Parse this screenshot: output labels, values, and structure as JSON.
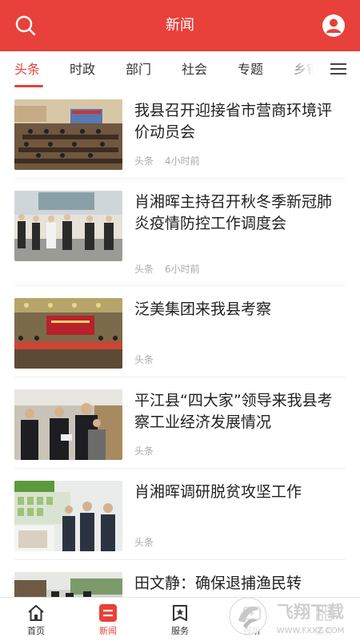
{
  "header": {
    "title": "新闻",
    "search_icon": "search-icon",
    "user_icon": "user-icon",
    "accent": "#e8403a"
  },
  "tabs": [
    {
      "label": "头条",
      "active": true
    },
    {
      "label": "时政",
      "active": false
    },
    {
      "label": "部门",
      "active": false
    },
    {
      "label": "社会",
      "active": false
    },
    {
      "label": "专题",
      "active": false
    },
    {
      "label": "乡镇",
      "active": false
    }
  ],
  "menu_icon": "menu-icon",
  "news": [
    {
      "title": "我县召开迎接省市营商环境评价动员会",
      "source": "头条",
      "time": "4小时前"
    },
    {
      "title": "肖湘晖主持召开秋冬季新冠肺炎疫情防控工作调度会",
      "source": "头条",
      "time": "6小时前"
    },
    {
      "title": "泛美集团来我县考察",
      "source": "头条",
      "time": ""
    },
    {
      "title": "平江县“四大家”领导来我县考察工业经济发展情况",
      "source": "头条",
      "time": ""
    },
    {
      "title": "肖湘晖调研脱贫攻坚工作",
      "source": "头条",
      "time": ""
    },
    {
      "title": "田文静：确保退捕渔民转",
      "source": "",
      "time": ""
    }
  ],
  "tabbar": [
    {
      "label": "首页",
      "icon": "home-icon",
      "active": false
    },
    {
      "label": "新闻",
      "icon": "news-icon",
      "active": true
    },
    {
      "label": "服务",
      "icon": "service-icon",
      "active": false
    },
    {
      "label": "视听",
      "icon": "video-icon",
      "active": false
    },
    {
      "label": "服务",
      "icon": "grid-icon",
      "active": false
    }
  ],
  "watermark": {
    "brand": "飞翔下载",
    "url": "WWW.FXXZ.COM"
  }
}
